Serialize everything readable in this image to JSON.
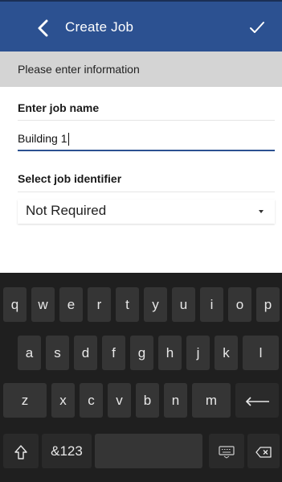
{
  "header": {
    "title": "Create Job",
    "bg_color": "#2c5191",
    "back_icon": "chevron-left-icon",
    "confirm_icon": "check-icon"
  },
  "subheader": {
    "text": "Please enter information"
  },
  "form": {
    "job_name_label": "Enter job name",
    "job_name_value": "Building 1",
    "identifier_label": "Select job identifier",
    "identifier_value": "Not Required"
  },
  "keyboard": {
    "row1": [
      "q",
      "w",
      "e",
      "r",
      "t",
      "y",
      "u",
      "i",
      "o",
      "p"
    ],
    "row2": [
      "a",
      "s",
      "d",
      "f",
      "g",
      "h",
      "j",
      "k",
      "l"
    ],
    "row3": [
      "z",
      "x",
      "c",
      "v",
      "b",
      "n",
      "m"
    ],
    "symbols_label": "&123",
    "icons": [
      "shift-icon",
      "enter-icon",
      "keyboard-icon",
      "backspace-icon"
    ]
  }
}
